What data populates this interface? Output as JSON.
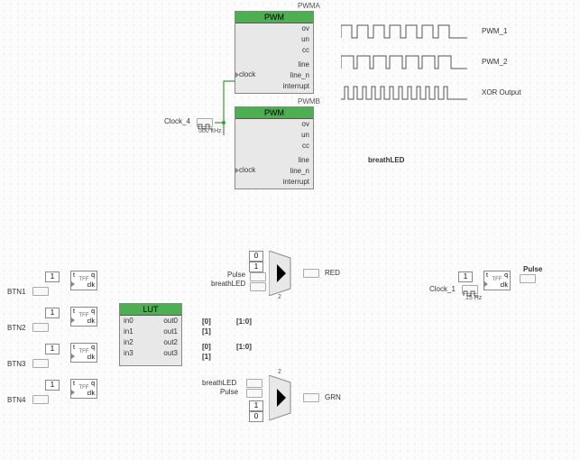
{
  "pwm_a": {
    "header": "PWMA",
    "title": "PWM",
    "ports_r": [
      "ov",
      "un",
      "cc",
      "line",
      "line_n",
      "interrupt"
    ],
    "port_clock": "clock"
  },
  "pwm_b": {
    "header": "PWMB",
    "title": "PWM",
    "ports_r": [
      "ov",
      "un",
      "cc",
      "line",
      "line_n",
      "interrupt"
    ],
    "port_clock": "clock"
  },
  "clock4": {
    "name": "Clock_4",
    "freq": "500 kHz"
  },
  "clock1": {
    "name": "Clock_1",
    "freq": "15 Hz"
  },
  "waveforms": {
    "pwm1": "PWM_1",
    "pwm2": "PWM_2",
    "xor": "XOR Output"
  },
  "xor_out_net": "breathLED",
  "lut": {
    "title": "LUT",
    "ins": [
      "in0",
      "in1",
      "in2",
      "in3"
    ],
    "outs": [
      "out0",
      "out1",
      "out2",
      "out3"
    ]
  },
  "btns": [
    "BTN1",
    "BTN2",
    "BTN3",
    "BTN4"
  ],
  "tff": {
    "t": "t",
    "q": "q",
    "lbl": "TFF",
    "clk": "clk"
  },
  "consts": {
    "one": "1",
    "zero": "0"
  },
  "mux_red": {
    "in3": "Pulse",
    "in2": "breathLED",
    "out": "RED"
  },
  "mux_grn": {
    "in3": "breathLED",
    "in2": "Pulse",
    "out": "GRN"
  },
  "pulse_net": "Pulse",
  "bus": {
    "pair_top": "[0]",
    "pair_top2": "[1]",
    "range": "[1:0]",
    "pair_bot": "[0]",
    "pair_bot2": "[1]"
  }
}
